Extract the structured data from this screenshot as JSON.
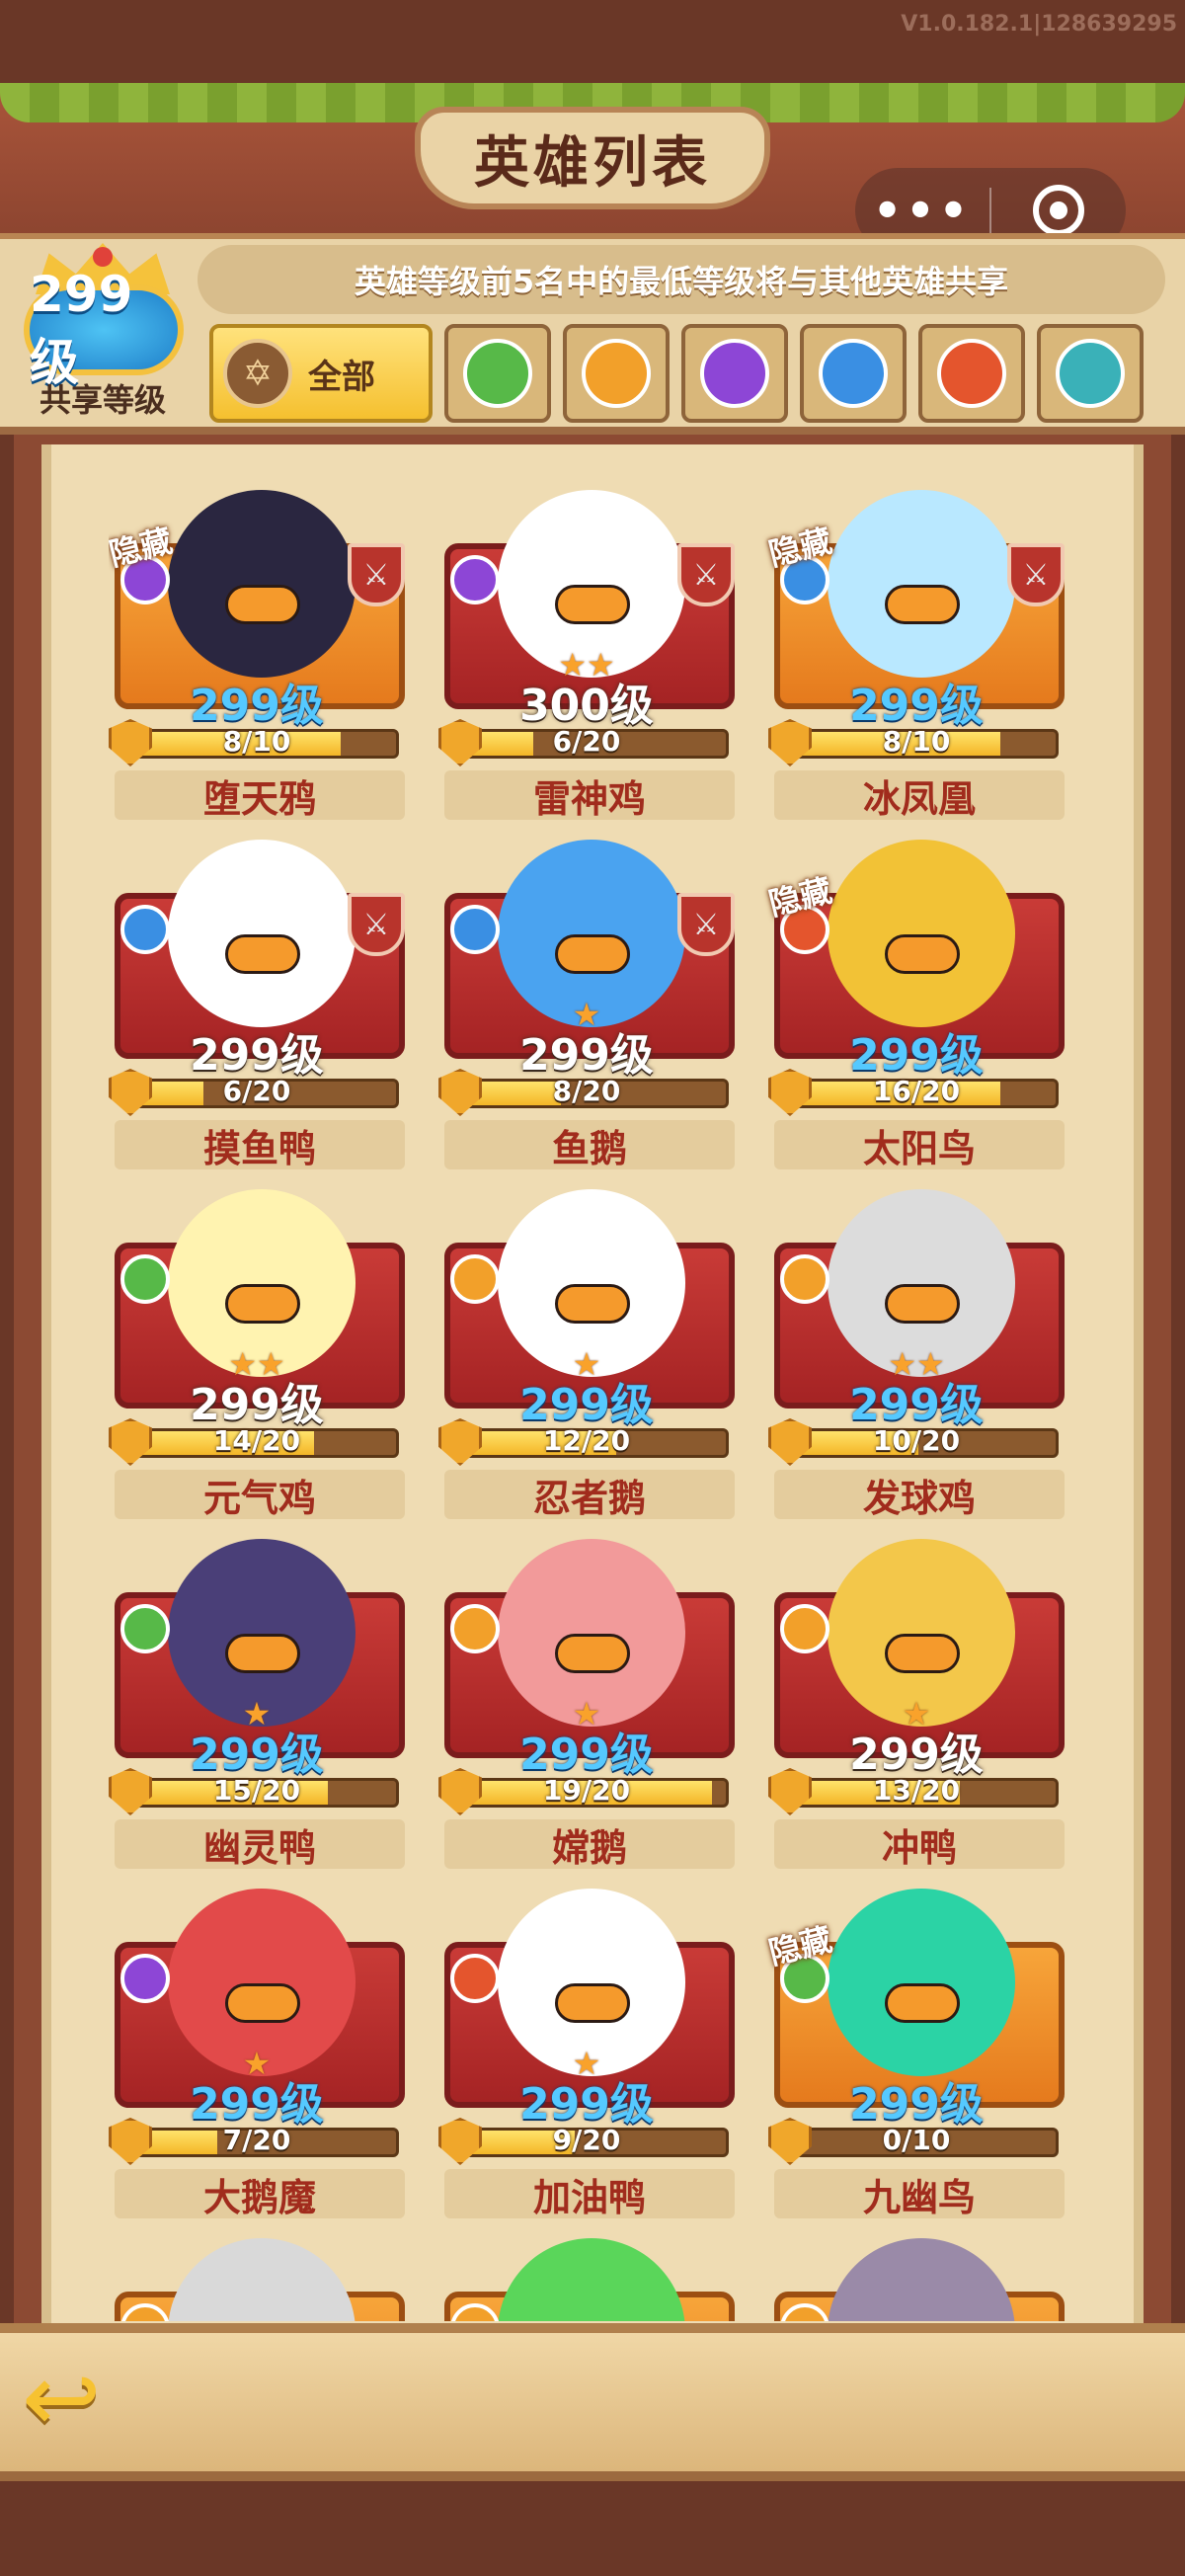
{
  "version": "V1.0.182.1|128639295",
  "title": "英雄列表",
  "notice": "英雄等级前5名中的最低等级将与其他英雄共享",
  "shared": {
    "level": "299级",
    "label": "共享等级"
  },
  "filters": {
    "all_label": "全部",
    "elements": [
      {
        "icon": "leaf-element-icon",
        "color": "#57b948"
      },
      {
        "icon": "swirl-element-icon",
        "color": "#f2a02a"
      },
      {
        "icon": "lightning-element-icon",
        "color": "#8d46d6"
      },
      {
        "icon": "snowflake-element-icon",
        "color": "#3a8fe3"
      },
      {
        "icon": "fire-element-icon",
        "color": "#e4552d"
      },
      {
        "icon": "water-element-icon",
        "color": "#3ab1b8"
      }
    ]
  },
  "hidden_label": "隐藏",
  "heroes": [
    {
      "name": "堕天鸦",
      "level": "299级",
      "levelColor": "blue",
      "progress": "8/10",
      "fill": 0.8,
      "stars": "",
      "hidden": true,
      "bg": "gold",
      "elem": "#8d46d6",
      "sword": true,
      "skin": "#2a2640"
    },
    {
      "name": "雷神鸡",
      "level": "300级",
      "levelColor": "white",
      "progress": "6/20",
      "fill": 0.3,
      "stars": "★★",
      "hidden": false,
      "bg": "red",
      "elem": "#8d46d6",
      "sword": true,
      "skin": "#ffffff"
    },
    {
      "name": "冰凤凰",
      "level": "299级",
      "levelColor": "blue",
      "progress": "8/10",
      "fill": 0.8,
      "stars": "",
      "hidden": true,
      "bg": "gold",
      "elem": "#3a8fe3",
      "sword": true,
      "skin": "#b9e8ff"
    },
    {
      "name": "摸鱼鸭",
      "level": "299级",
      "levelColor": "white",
      "progress": "6/20",
      "fill": 0.3,
      "stars": "",
      "hidden": false,
      "bg": "red",
      "elem": "#3a8fe3",
      "sword": true,
      "skin": "#ffffff"
    },
    {
      "name": "鱼鹅",
      "level": "299级",
      "levelColor": "white",
      "progress": "8/20",
      "fill": 0.4,
      "stars": "★",
      "hidden": false,
      "bg": "red",
      "elem": "#3a8fe3",
      "sword": true,
      "skin": "#4aa3f0"
    },
    {
      "name": "太阳鸟",
      "level": "299级",
      "levelColor": "blue",
      "progress": "16/20",
      "fill": 0.8,
      "stars": "",
      "hidden": true,
      "bg": "red",
      "elem": "#e4552d",
      "sword": false,
      "skin": "#f2c236"
    },
    {
      "name": "元气鸡",
      "level": "299级",
      "levelColor": "white",
      "progress": "14/20",
      "fill": 0.7,
      "stars": "★★",
      "hidden": false,
      "bg": "red",
      "elem": "#57b948",
      "sword": false,
      "skin": "#fff3b0"
    },
    {
      "name": "忍者鹅",
      "level": "299级",
      "levelColor": "blue",
      "progress": "12/20",
      "fill": 0.6,
      "stars": "★",
      "hidden": false,
      "bg": "red",
      "elem": "#f2a02a",
      "sword": false,
      "skin": "#ffffff"
    },
    {
      "name": "发球鸡",
      "level": "299级",
      "levelColor": "blue",
      "progress": "10/20",
      "fill": 0.5,
      "stars": "★★",
      "hidden": false,
      "bg": "red",
      "elem": "#f2a02a",
      "sword": false,
      "skin": "#dcdcdc"
    },
    {
      "name": "幽灵鸭",
      "level": "299级",
      "levelColor": "blue",
      "progress": "15/20",
      "fill": 0.75,
      "stars": "★",
      "hidden": false,
      "bg": "red",
      "elem": "#57b948",
      "sword": false,
      "skin": "#4a3f78"
    },
    {
      "name": "嫦鹅",
      "level": "299级",
      "levelColor": "blue",
      "progress": "19/20",
      "fill": 0.95,
      "stars": "★",
      "hidden": false,
      "bg": "red",
      "elem": "#f2a02a",
      "sword": false,
      "skin": "#f29a9a"
    },
    {
      "name": "冲鸭",
      "level": "299级",
      "levelColor": "white",
      "progress": "13/20",
      "fill": 0.65,
      "stars": "★",
      "hidden": false,
      "bg": "red",
      "elem": "#f2a02a",
      "sword": false,
      "skin": "#f3c74a"
    },
    {
      "name": "大鹅魔",
      "level": "299级",
      "levelColor": "blue",
      "progress": "7/20",
      "fill": 0.35,
      "stars": "★",
      "hidden": false,
      "bg": "red",
      "elem": "#8d46d6",
      "sword": false,
      "skin": "#e24a4a"
    },
    {
      "name": "加油鸭",
      "level": "299级",
      "levelColor": "blue",
      "progress": "9/20",
      "fill": 0.45,
      "stars": "★",
      "hidden": false,
      "bg": "red",
      "elem": "#e4552d",
      "sword": false,
      "skin": "#ffffff"
    },
    {
      "name": "九幽鸟",
      "level": "299级",
      "levelColor": "blue",
      "progress": "0/10",
      "fill": 0.0,
      "stars": "",
      "hidden": true,
      "bg": "gold",
      "elem": "#57b948",
      "sword": false,
      "skin": "#2bd3a5"
    }
  ],
  "partial_heroes": [
    {
      "bg": "gold",
      "elem": "#f2a02a",
      "skin": "#d9d9d9"
    },
    {
      "bg": "gold",
      "elem": "#f2a02a",
      "skin": "#5ad65a"
    },
    {
      "bg": "gold",
      "elem": "#f2a02a",
      "skin": "#9a8aa8"
    }
  ]
}
